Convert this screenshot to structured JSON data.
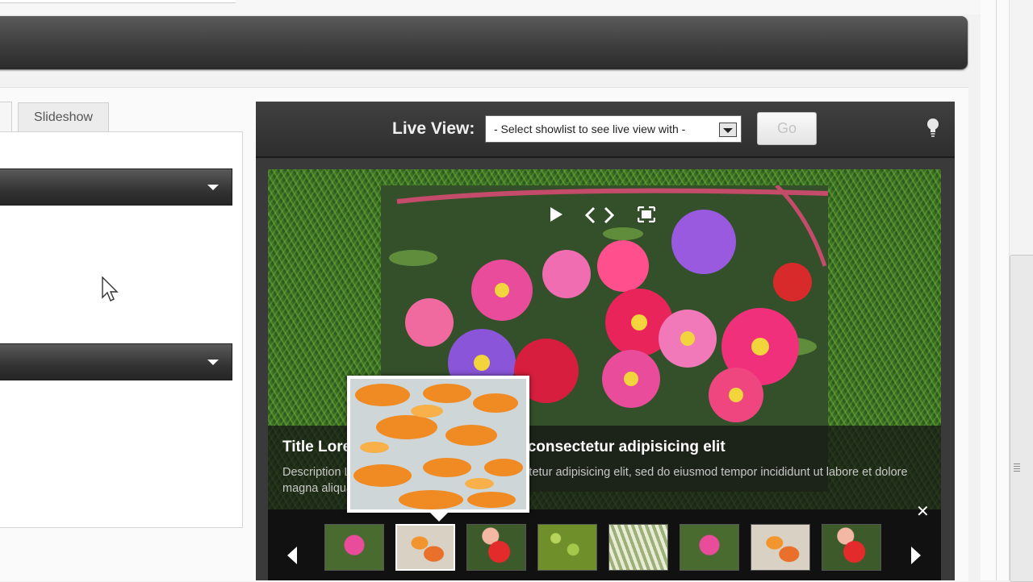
{
  "tabs": {
    "slideshow": "Slideshow"
  },
  "preview": {
    "live_view_label": "Live View:",
    "showlist_select": "- Select showlist to see live view with -",
    "go_button": "Go"
  },
  "slide": {
    "title": "Title Lorem ipsum dolor sit amet, consectetur adipisicing elit",
    "description": "Description Lorem ipsum dolor sit amet, consectetur adipisicing elit, sed do eiusmod tempor incididunt ut labore et dolore magna aliqua."
  },
  "icons": [
    "play-icon",
    "prev-icon",
    "next-icon",
    "fullscreen-icon",
    "close-icon",
    "lightbulb-icon",
    "cursor-icon"
  ],
  "thumbnails": [
    "flowers-pink",
    "goldfish",
    "flower-red",
    "green-grapes",
    "white-flowers",
    "flowers-pink",
    "goldfish",
    "flower-red"
  ],
  "colors": {
    "topbar": "#3e3e3e",
    "preview_bg": "#3a3a3a",
    "filmstrip": "#111111"
  }
}
